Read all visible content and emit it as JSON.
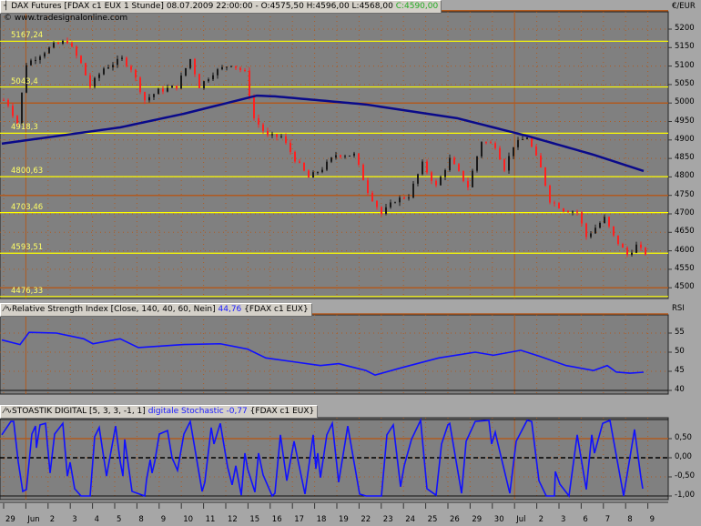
{
  "header": {
    "symbol": "DAX Futures [FDAX c1 EUX  1 Stunde]",
    "timestamp": "08.07.2009 22:00:00 -",
    "ohl": "O:4575,50 H:4596,00 L:4568,00",
    "close": "C:4590,00"
  },
  "copyright": "© www.tradesignalonline.com",
  "rsi_header": {
    "title": "Relative Strength Index [Close, 140, 40, 60, Nein]",
    "value": "44,76",
    "source": "{FDAX c1 EUX}"
  },
  "stoch_header": {
    "title": "STOASTIK DIGITAL [5, 3, 3, -1, 1]",
    "value": "digitale Stochastic -0,77",
    "source": "{FDAX c1 EUX}"
  },
  "colors": {
    "plot_bg": "#808080",
    "up": "#1a1a1a",
    "down": "#ff2020",
    "ma": "#0a0a8a",
    "indicator": "#1010ff",
    "level": "#ffff00",
    "major_grid": "#b05a20"
  },
  "chart_data": [
    {
      "type": "candlestick",
      "title": "DAX Futures 1 Stunde",
      "ylabel": "€/EUR",
      "ylim": [
        4475,
        5260
      ],
      "yticks": [
        "5200",
        "5150",
        "5100",
        "5050",
        "5000",
        "4950",
        "4900",
        "4850",
        "4800",
        "4750",
        "4700",
        "4650",
        "4600",
        "4550",
        "4500"
      ],
      "ytick_values": [
        5200,
        5150,
        5100,
        5050,
        5000,
        4950,
        4900,
        4850,
        4800,
        4750,
        4700,
        4650,
        4600,
        4550,
        4500
      ],
      "major_lines": [
        5250,
        5000,
        4750,
        4500
      ],
      "levels": [
        {
          "value": 5167.24,
          "label": "5167,24"
        },
        {
          "value": 5043.4,
          "label": "5043,4"
        },
        {
          "value": 4918.3,
          "label": "4918,3"
        },
        {
          "value": 4800.63,
          "label": "4800,63"
        },
        {
          "value": 4703.46,
          "label": "4703,46"
        },
        {
          "value": 4593.51,
          "label": "4593,51"
        },
        {
          "value": 4476.33,
          "label": "4476,33"
        }
      ],
      "price_path": [
        [
          0,
          5008
        ],
        [
          1,
          4996
        ],
        [
          3,
          4946
        ],
        [
          5,
          5106
        ],
        [
          8,
          5131
        ],
        [
          11,
          5156
        ],
        [
          14,
          5168
        ],
        [
          17,
          5106
        ],
        [
          19,
          5045
        ],
        [
          22,
          5094
        ],
        [
          26,
          5119
        ],
        [
          28,
          5094
        ],
        [
          31,
          5008
        ],
        [
          34,
          5033
        ],
        [
          38,
          5045
        ],
        [
          41,
          5119
        ],
        [
          43,
          5045
        ],
        [
          46,
          5082
        ],
        [
          50,
          5106
        ],
        [
          53,
          5082
        ],
        [
          55,
          4959
        ],
        [
          58,
          4909
        ],
        [
          61,
          4909
        ],
        [
          64,
          4848
        ],
        [
          67,
          4798
        ],
        [
          70,
          4823
        ],
        [
          73,
          4860
        ],
        [
          77,
          4860
        ],
        [
          80,
          4762
        ],
        [
          83,
          4700
        ],
        [
          86,
          4737
        ],
        [
          89,
          4749
        ],
        [
          92,
          4835
        ],
        [
          95,
          4774
        ],
        [
          98,
          4848
        ],
        [
          102,
          4774
        ],
        [
          105,
          4897
        ],
        [
          108,
          4885
        ],
        [
          110,
          4823
        ],
        [
          112,
          4885
        ],
        [
          115,
          4909
        ],
        [
          118,
          4823
        ],
        [
          120,
          4737
        ],
        [
          123,
          4712
        ],
        [
          126,
          4705
        ],
        [
          128,
          4638
        ],
        [
          132,
          4688
        ],
        [
          134,
          4638
        ],
        [
          137,
          4589
        ],
        [
          139,
          4614
        ],
        [
          141,
          4590
        ]
      ],
      "moving_average": [
        [
          0,
          4890
        ],
        [
          26,
          4934
        ],
        [
          40,
          4971
        ],
        [
          56,
          5020
        ],
        [
          60,
          5018
        ],
        [
          80,
          4996
        ],
        [
          100,
          4959
        ],
        [
          116,
          4909
        ],
        [
          130,
          4860
        ],
        [
          141,
          4816
        ]
      ]
    },
    {
      "type": "line",
      "title": "Relative Strength Index",
      "ylabel": "RSI",
      "yticks": [
        "55",
        "50",
        "45",
        "40"
      ],
      "ytick_values": [
        55,
        50,
        45,
        40
      ],
      "upper_line": 60,
      "lower_line": 40,
      "series": [
        [
          0,
          53.2
        ],
        [
          4,
          52
        ],
        [
          6,
          55.2
        ],
        [
          12,
          55
        ],
        [
          18,
          53.5
        ],
        [
          20,
          52.2
        ],
        [
          26,
          53.5
        ],
        [
          30,
          51.2
        ],
        [
          40,
          52
        ],
        [
          48,
          52.2
        ],
        [
          54,
          50.8
        ],
        [
          58,
          48.5
        ],
        [
          64,
          47.5
        ],
        [
          70,
          46.5
        ],
        [
          74,
          47
        ],
        [
          80,
          45.2
        ],
        [
          82,
          44
        ],
        [
          88,
          46
        ],
        [
          96,
          48.5
        ],
        [
          104,
          50
        ],
        [
          108,
          49.2
        ],
        [
          114,
          50.5
        ],
        [
          118,
          49
        ],
        [
          124,
          46.5
        ],
        [
          130,
          45.2
        ],
        [
          133,
          46.5
        ],
        [
          135,
          44.8
        ],
        [
          138,
          44.5
        ],
        [
          141,
          44.76
        ]
      ]
    },
    {
      "type": "line",
      "title": "digitale Stochastic",
      "yticks": [
        "0,50",
        "0,00",
        "-0,50",
        "-1,00"
      ],
      "ytick_values": [
        0.5,
        0,
        -0.5,
        -1
      ],
      "series": [
        [
          0,
          0.6
        ],
        [
          2,
          0.95
        ],
        [
          2.6,
          0.95
        ],
        [
          3.6,
          -0.1
        ],
        [
          4.6,
          -0.88
        ],
        [
          5.4,
          -0.83
        ],
        [
          6.6,
          0.62
        ],
        [
          7.4,
          0.83
        ],
        [
          7.6,
          0.26
        ],
        [
          8.4,
          0.86
        ],
        [
          9.6,
          0.9
        ],
        [
          10.6,
          -0.4
        ],
        [
          11.6,
          0.62
        ],
        [
          13.4,
          0.9
        ],
        [
          14.4,
          -0.48
        ],
        [
          15,
          -0.12
        ],
        [
          16,
          -0.81
        ],
        [
          17.4,
          -1
        ],
        [
          19.4,
          -1
        ],
        [
          20.4,
          0.55
        ],
        [
          21.4,
          0.79
        ],
        [
          23,
          -0.48
        ],
        [
          25,
          0.83
        ],
        [
          26,
          -0.1
        ],
        [
          26.6,
          -0.48
        ],
        [
          27,
          0.48
        ],
        [
          28.6,
          -0.88
        ],
        [
          31.4,
          -1
        ],
        [
          31.8,
          -0.57
        ],
        [
          32.6,
          -0.05
        ],
        [
          33,
          -0.4
        ],
        [
          33.6,
          -0.1
        ],
        [
          34.6,
          0.62
        ],
        [
          36.4,
          0.71
        ],
        [
          37.4,
          0
        ],
        [
          38.6,
          -0.33
        ],
        [
          40,
          0.62
        ],
        [
          41.4,
          0.95
        ],
        [
          44,
          -0.88
        ],
        [
          44.6,
          -0.64
        ],
        [
          46,
          0.79
        ],
        [
          46.6,
          0.36
        ],
        [
          48,
          0.9
        ],
        [
          49.6,
          -0.24
        ],
        [
          50.6,
          -0.71
        ],
        [
          51.4,
          -0.21
        ],
        [
          52.6,
          -0.98
        ],
        [
          53.4,
          0.12
        ],
        [
          54,
          -0.29
        ],
        [
          55.6,
          -0.9
        ],
        [
          56.4,
          0.12
        ],
        [
          57.4,
          -0.45
        ],
        [
          59.4,
          -1
        ],
        [
          60,
          -0.93
        ],
        [
          61.2,
          0.6
        ],
        [
          62.6,
          -0.6
        ],
        [
          64.2,
          0.43
        ],
        [
          66.6,
          -0.95
        ],
        [
          68.4,
          0.6
        ],
        [
          69,
          -0.29
        ],
        [
          69.4,
          0.12
        ],
        [
          70,
          -0.52
        ],
        [
          71.4,
          0.6
        ],
        [
          72.6,
          0.9
        ],
        [
          74,
          -0.64
        ],
        [
          76,
          0.83
        ],
        [
          78.6,
          -0.95
        ],
        [
          80,
          -1
        ],
        [
          83.4,
          -1
        ],
        [
          84.6,
          0.6
        ],
        [
          86,
          0.86
        ],
        [
          87.6,
          -0.76
        ],
        [
          88.4,
          -0.21
        ],
        [
          90,
          0.48
        ],
        [
          92,
          0.98
        ],
        [
          93.4,
          -0.81
        ],
        [
          95.4,
          -0.98
        ],
        [
          96.6,
          0.36
        ],
        [
          98,
          0.86
        ],
        [
          98.4,
          0.9
        ],
        [
          101,
          -0.93
        ],
        [
          102,
          0.43
        ],
        [
          104,
          0.95
        ],
        [
          107,
          0.98
        ],
        [
          107.6,
          0.36
        ],
        [
          108.4,
          0.67
        ],
        [
          109,
          0.36
        ],
        [
          111.6,
          -0.93
        ],
        [
          113,
          0.43
        ],
        [
          115.4,
          0.98
        ],
        [
          116.4,
          0.95
        ],
        [
          118,
          -0.6
        ],
        [
          119.6,
          -1
        ],
        [
          121.4,
          -1
        ],
        [
          121.6,
          -0.36
        ],
        [
          122.6,
          -0.69
        ],
        [
          124.6,
          -1
        ],
        [
          126.4,
          0.6
        ],
        [
          128.4,
          -0.83
        ],
        [
          129.6,
          0.6
        ],
        [
          130.2,
          0.12
        ],
        [
          132,
          0.9
        ],
        [
          133.6,
          0.98
        ],
        [
          136.6,
          -1
        ],
        [
          139,
          0.74
        ],
        [
          140.4,
          -0.52
        ],
        [
          140.8,
          -0.81
        ]
      ]
    }
  ],
  "x_axis": {
    "labels": [
      "29",
      "Jun",
      "2",
      "3",
      "4",
      "5",
      "8",
      "9",
      "10",
      "11",
      "12",
      "15",
      "16",
      "17",
      "18",
      "19",
      "22",
      "23",
      "24",
      "25",
      "26",
      "29",
      "30",
      "Jul",
      "2",
      "3",
      "6",
      "7",
      "8",
      "9"
    ],
    "month_starts": [
      1,
      23
    ]
  }
}
